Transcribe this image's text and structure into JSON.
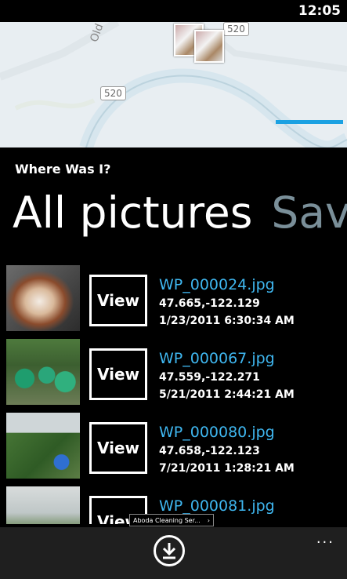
{
  "status_bar": {
    "time": "12:05"
  },
  "map": {
    "highway_labels": [
      "520",
      "520"
    ],
    "road_text": "Old",
    "accent_color": "#1ba1e2"
  },
  "app_title": "Where Was I?",
  "pivot": {
    "active": "All pictures",
    "next": "Sav"
  },
  "pictures": [
    {
      "file": "WP_000024.jpg",
      "coords": "47.665,-122.129",
      "timestamp": "1/23/2011 6:30:34 AM",
      "button": "View"
    },
    {
      "file": "WP_000067.jpg",
      "coords": "47.559,-122.271",
      "timestamp": "5/21/2011 2:44:21 AM",
      "button": "View"
    },
    {
      "file": "WP_000080.jpg",
      "coords": "47.658,-122.123",
      "timestamp": "7/21/2011 1:28:21 AM",
      "button": "View"
    },
    {
      "file": "WP_000081.jpg",
      "coords": "",
      "timestamp": "",
      "button": "View"
    }
  ],
  "ad_banner": {
    "text": "Aboda Cleaning Ser..."
  },
  "app_bar": {
    "primary_icon": "download-icon",
    "more_label": "..."
  }
}
